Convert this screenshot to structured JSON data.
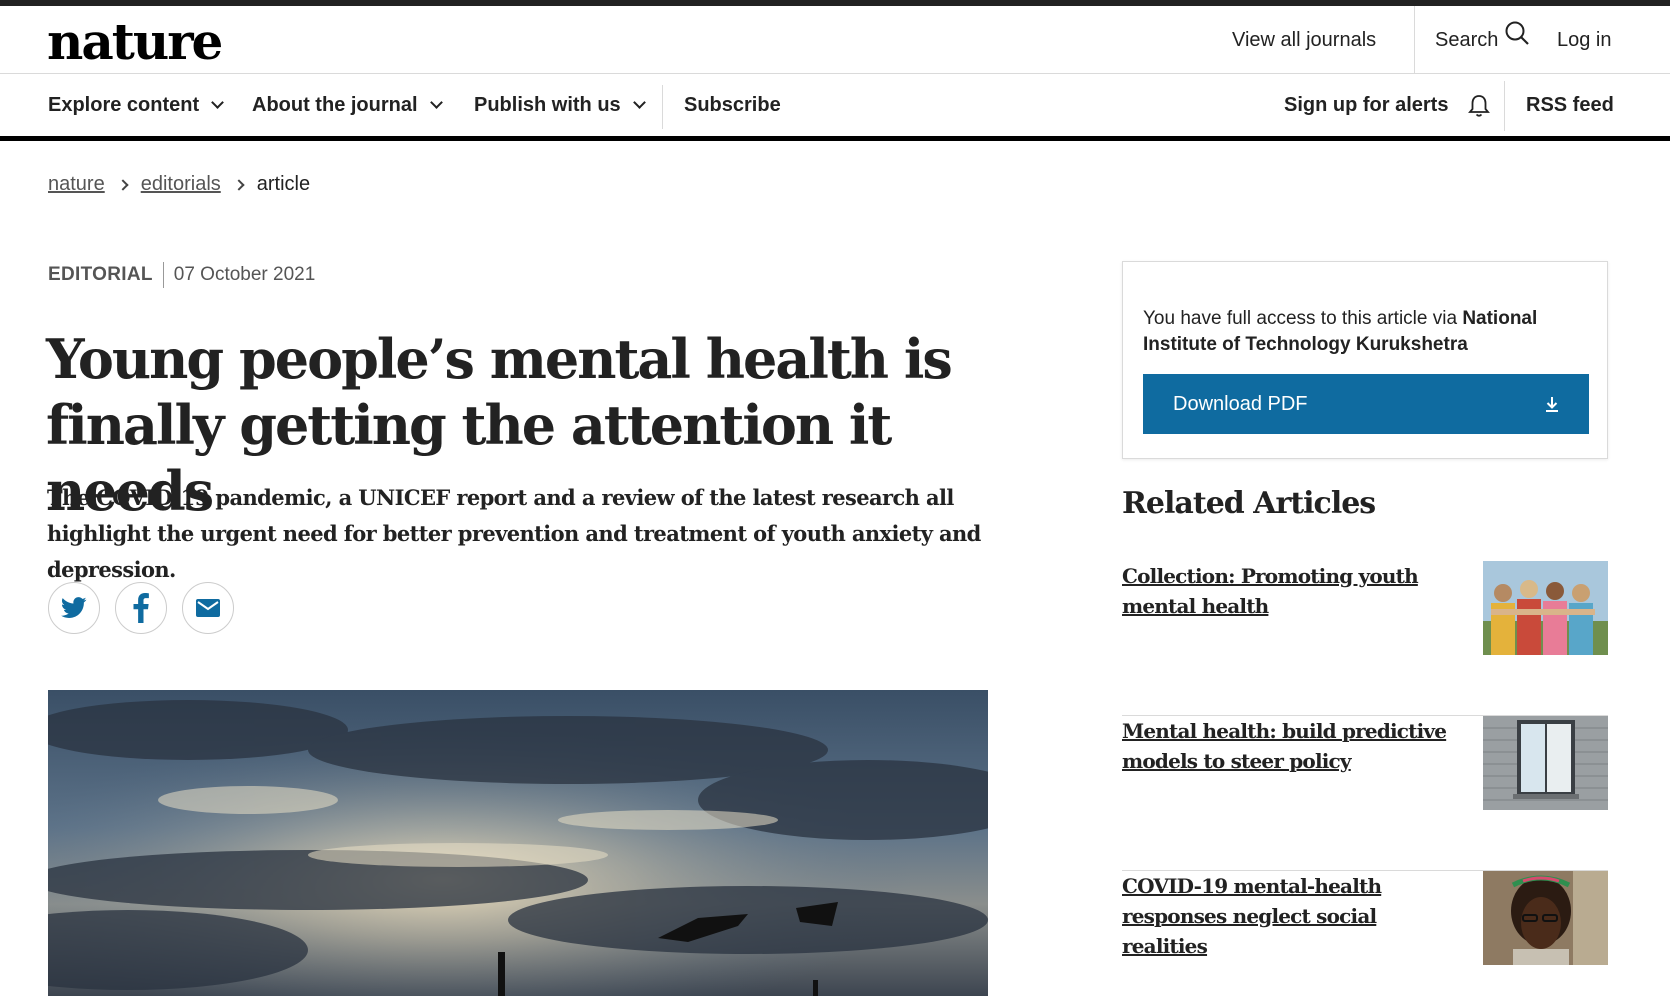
{
  "header": {
    "logo": "nature",
    "view_all_journals": "View all journals",
    "search": "Search",
    "login": "Log in"
  },
  "nav": {
    "items": [
      {
        "label": "Explore content"
      },
      {
        "label": "About the journal"
      },
      {
        "label": "Publish with us"
      }
    ],
    "subscribe": "Subscribe",
    "alerts": "Sign up for alerts",
    "rss": "RSS feed"
  },
  "breadcrumb": {
    "items": [
      "nature",
      "editorials"
    ],
    "current": "article"
  },
  "article": {
    "type": "EDITORIAL",
    "date": "07 October 2021",
    "title_line1": "Young people’s mental health is",
    "title_line2": "finally getting the attention it needs",
    "standfirst": "The COVID-19 pandemic, a UNICEF report and a review of the latest research all highlight the urgent need for better prevention and treatment of youth anxiety and depression."
  },
  "share": {
    "icons": [
      "twitter-icon",
      "facebook-icon",
      "email-icon"
    ]
  },
  "sidebar": {
    "access_prefix": "You have full access to this article via ",
    "access_institution": "National Institute of Technology Kurukshetra",
    "download_pdf": "Download PDF",
    "related_heading": "Related Articles",
    "related": [
      {
        "title": "Collection: Promoting youth mental health"
      },
      {
        "title": "Mental health: build predictive models to steer policy"
      },
      {
        "title": "COVID-19 mental-health responses neglect social realities"
      }
    ]
  },
  "colors": {
    "accent": "#0f6ba0",
    "text": "#222222",
    "divider": "#dadada"
  }
}
